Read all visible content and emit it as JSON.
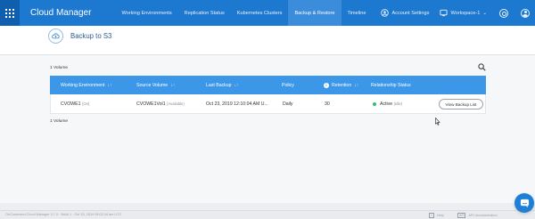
{
  "app": {
    "title": "Cloud Manager"
  },
  "nav": {
    "items": [
      {
        "label": "Working Environments"
      },
      {
        "label": "Replication Status"
      },
      {
        "label": "Kubernetes Clusters"
      },
      {
        "label": "Backup & Restore"
      },
      {
        "label": "Timeline"
      }
    ],
    "active_index": 3
  },
  "topbar": {
    "account_settings": "Account Settings",
    "workspace": "Workspace-1",
    "workspace_chevron": "⌄"
  },
  "page": {
    "title": "Backup to S3",
    "volume_count_top": "1 Volume",
    "volume_count_bottom": "1 Volume"
  },
  "table": {
    "columns": [
      {
        "label": "Working Environment",
        "sort": "↓↑"
      },
      {
        "label": "Source Volume",
        "sort": "↓↑"
      },
      {
        "label": "Last Backup",
        "sort": "↓↑"
      },
      {
        "label": "Policy",
        "sort": ""
      },
      {
        "label": "Retention",
        "sort": "↓↑"
      },
      {
        "label": "Relationship Status",
        "sort": ""
      }
    ],
    "rows": [
      {
        "working_environment": "CVOWE1",
        "we_state": "(On)",
        "source_volume": "CVOWE1Vol1",
        "volume_state": "(Available)",
        "last_backup": "Oct 23, 2019 12:10:04 AM U...",
        "policy": "Daily",
        "retention": "30",
        "status": "Active",
        "status_sub": "(Idle)",
        "action": "View Backup List"
      }
    ]
  },
  "footer": {
    "version": "OnCommand Cloud Manager 3.7.0 · Build 1 · Oct 15, 2019 08:02:34 am UTC",
    "help_tag": "?",
    "help": "Help",
    "api_tag": "API",
    "api": "API documentation"
  },
  "colors": {
    "topbar": "#1d78cf",
    "table_header": "#3d97e8",
    "active_status": "#2fbf71",
    "chat_button": "#1f7fd6"
  },
  "icons": [
    "apps-grid-icon",
    "account-settings-icon",
    "workspace-icon",
    "gear-icon",
    "user-icon",
    "backup-cloud-icon",
    "search-icon",
    "info-icon",
    "chat-icon",
    "mouse-cursor-icon"
  ]
}
